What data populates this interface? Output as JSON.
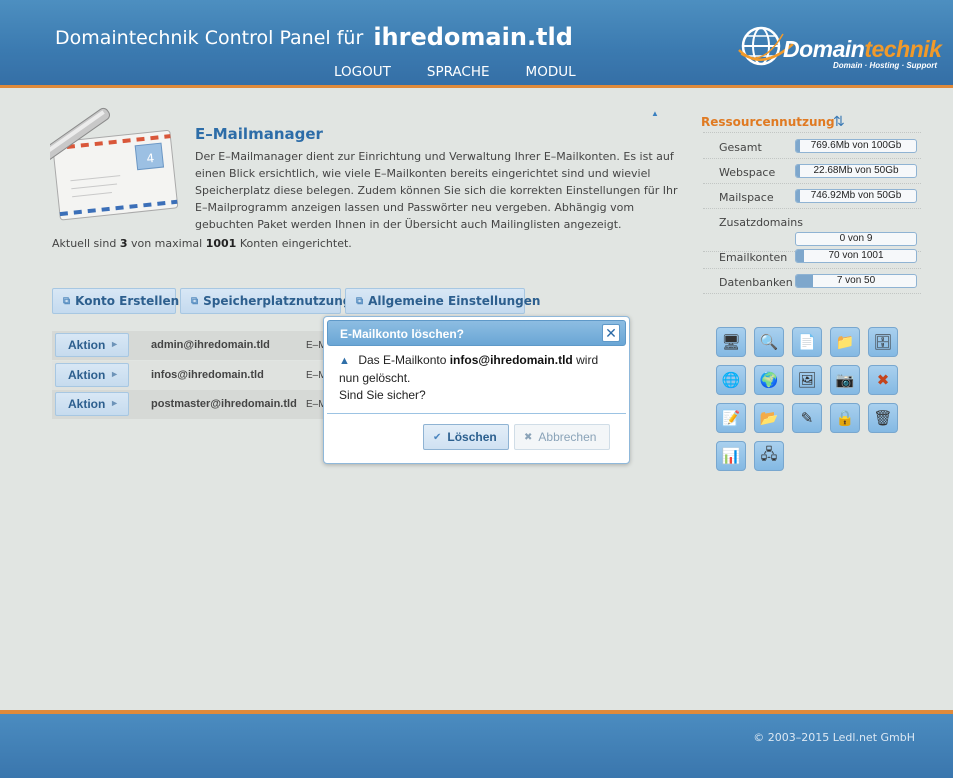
{
  "header": {
    "title_prefix": "Domaintechnik Control Panel für",
    "domain": "ihredomain.tld",
    "nav": [
      "LOGOUT",
      "SPRACHE",
      "MODUL"
    ],
    "logo_main": "Domain",
    "logo_accent": "technik",
    "logo_tagline": "Domain · Hosting · Support"
  },
  "intro": {
    "title": "E–Mailmanager",
    "description": "Der E–Mailmanager dient zur Einrichtung und Verwaltung Ihrer E–Mailkonten. Es ist auf einen Blick ersichtlich, wie viele E–Mailkonten bereits eingerichtet sind und wieviel Speicherplatz diese belegen. Zudem können Sie sich die korrekten Einstellungen für Ihr E–Mailprogramm anzeigen lassen und Passwörter neu vergeben. Abhängig vom gebuchten Paket werden Ihnen in der Übersicht auch Mailinglisten angezeigt.",
    "status_pre": "Aktuell sind",
    "status_count": "3",
    "status_mid": "von maximal",
    "status_max": "1001",
    "status_post": "Konten eingerichtet."
  },
  "toolbar": {
    "create": "Konto Erstellen",
    "storage": "Speicherplatznutzung",
    "settings": "Allgemeine Einstellungen"
  },
  "accounts": [
    {
      "action": "Aktion",
      "email": "admin@ihredomain.tld",
      "type": "E–M"
    },
    {
      "action": "Aktion",
      "email": "infos@ihredomain.tld",
      "type": "E–M"
    },
    {
      "action": "Aktion",
      "email": "postmaster@ihredomain.tld",
      "type": "E–M"
    }
  ],
  "resources": {
    "title": "Ressourcennutzung",
    "items": [
      {
        "label": "Gesamt",
        "value": "769.6Mb von 100Gb",
        "fraction": 0.0077
      },
      {
        "label": "Webspace",
        "value": "22.68Mb von 50Gb",
        "fraction": 0.0005
      },
      {
        "label": "Mailspace",
        "value": "746.92Mb von 50Gb",
        "fraction": 0.015
      },
      {
        "label": "Zusatzdomains",
        "value": "0 von 9",
        "fraction": 0
      },
      {
        "label": "Emailkonten",
        "value": "70 von 1001",
        "fraction": 0.07
      },
      {
        "label": "Datenbanken",
        "value": "7 von 50",
        "fraction": 0.14
      }
    ]
  },
  "tool_icons": [
    "webspace-icon",
    "search-icon",
    "document-icon",
    "folder-icon",
    "database-icon",
    "globe-dark-icon",
    "globe-icon",
    "image-icon",
    "camera-icon",
    "tools-icon",
    "notes-icon",
    "files-icon",
    "edit-icon",
    "lock-icon",
    "trash-icon",
    "chart-icon",
    "network-icon"
  ],
  "dialog": {
    "title": "E-Mailkonto löschen?",
    "text_pre": "Das E-Mailkonto",
    "email": "infos@ihredomain.tld",
    "text_post": "wird nun gelöscht.",
    "question": "Sind Sie sicher?",
    "confirm": "Löschen",
    "cancel": "Abbrechen"
  },
  "footer": {
    "copyright": "© 2003–2015 Ledl.net GmbH"
  },
  "colors": {
    "header": "#3b7ab0",
    "accent": "#e08a3a",
    "link": "#2d6da8",
    "background": "#e1e5e2"
  }
}
